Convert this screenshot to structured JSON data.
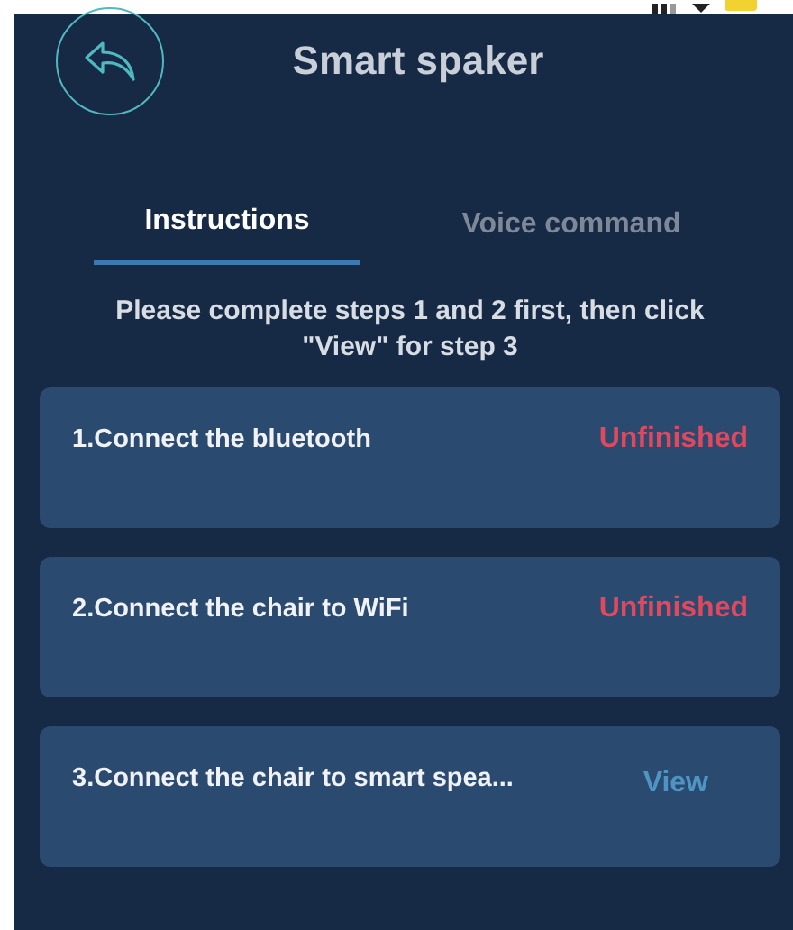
{
  "header": {
    "title": "Smart spaker"
  },
  "tabs": [
    {
      "label": "Instructions",
      "selected": true
    },
    {
      "label": "Voice command",
      "selected": false
    }
  ],
  "notice": "Please complete steps 1 and 2 first, then click \"View\" for step 3",
  "steps": [
    {
      "label": "1.Connect the bluetooth",
      "kind": "status",
      "status": "Unfinished"
    },
    {
      "label": "2.Connect the chair to WiFi",
      "kind": "status",
      "status": "Unfinished"
    },
    {
      "label": "3.Connect the chair to smart spea...",
      "kind": "action",
      "status": "View"
    }
  ]
}
